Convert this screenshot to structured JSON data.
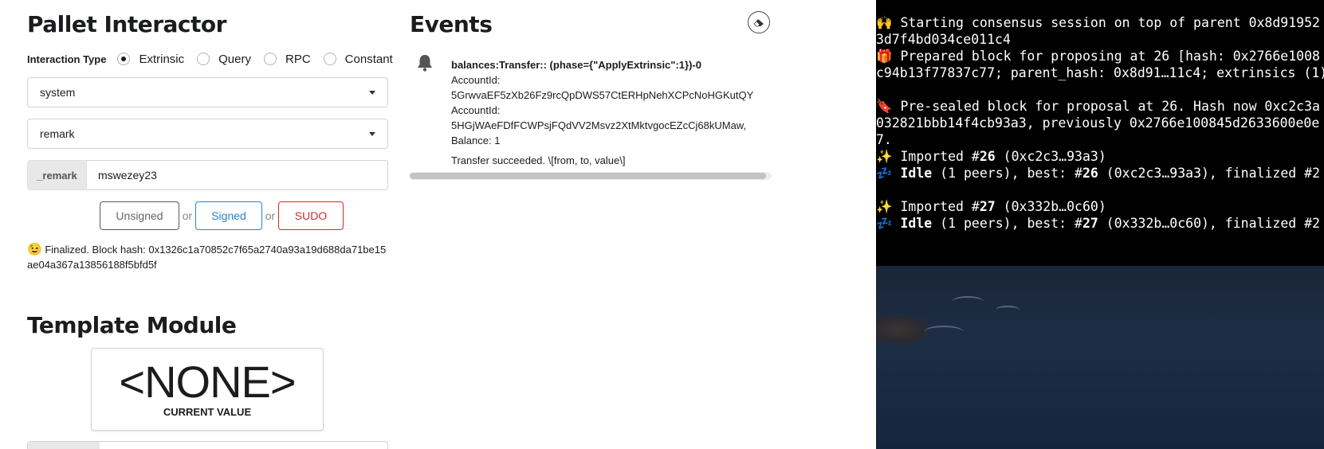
{
  "pallet": {
    "title": "Pallet Interactor",
    "interaction_type_label": "Interaction Type",
    "radios": [
      {
        "label": "Extrinsic",
        "checked": true
      },
      {
        "label": "Query",
        "checked": false
      },
      {
        "label": "RPC",
        "checked": false
      },
      {
        "label": "Constant",
        "checked": false
      }
    ],
    "pallet_select": "system",
    "callable_select": "remark",
    "param_label": "_remark",
    "param_value": "mswezey23",
    "buttons": {
      "unsigned": "Unsigned",
      "or1": "or",
      "signed": "Signed",
      "or2": "or",
      "sudo": "SUDO"
    },
    "status_text": "Finalized. Block hash: 0x1326c1a70852c7f65a2740a93a19d688da71be15ae04a367a13856188f5bfd5f"
  },
  "template": {
    "title": "Template Module",
    "value": "<NONE>",
    "caption": "CURRENT VALUE"
  },
  "events": {
    "title": "Events",
    "item": {
      "title": "balances:Transfer:: (phase={\"ApplyExtrinsic\":1})-0",
      "lines": [
        "AccountId:",
        "5GrwvaEF5zXb26Fz9rcQpDWS57CtERHpNehXCPcNoHGKutQY",
        "AccountId:",
        "5HGjWAeFDfFCWPsjFQdVV2Msvz2XtMktvgocEZcCj68kUMaw,",
        "Balance: 1"
      ],
      "description": "Transfer succeeded. \\[from, to, value\\]"
    }
  },
  "terminal": {
    "lines": [
      {
        "icon": "🙌",
        "text": " Starting consensus session on top of parent 0x8d91952"
      },
      {
        "icon": "",
        "text": "3d7f4bd034ce011c4"
      },
      {
        "icon": "🎁",
        "text": " Prepared block for proposing at 26 [hash: 0x2766e1008"
      },
      {
        "icon": "",
        "text": "c94b13f77837c77; parent_hash: 0x8d91…11c4; extrinsics (1)"
      },
      {
        "icon": "",
        "text": ""
      },
      {
        "icon": "🔖",
        "text": " Pre-sealed block for proposal at 26. Hash now 0xc2c3a"
      },
      {
        "icon": "",
        "text": "032821bbb14f4cb93a3, previously 0x2766e100845d2633600e0e"
      },
      {
        "icon": "",
        "text": "7."
      },
      {
        "icon": "✨",
        "text": " Imported #",
        "bold": "26",
        "rest": " (0xc2c3…93a3)"
      },
      {
        "icon": "💤",
        "text": " ",
        "bold": "Idle",
        "rest": " (1 peers), best: #",
        "bold2": "26",
        "rest2": " (0xc2c3…93a3), finalized #2"
      },
      {
        "icon": "",
        "text": ""
      },
      {
        "icon": "✨",
        "text": " Imported #",
        "bold": "27",
        "rest": " (0x332b…0c60)"
      },
      {
        "icon": "💤",
        "text": " ",
        "bold": "Idle",
        "rest": " (1 peers), best: #",
        "bold2": "27",
        "rest2": " (0x332b…0c60), finalized #2"
      }
    ]
  }
}
